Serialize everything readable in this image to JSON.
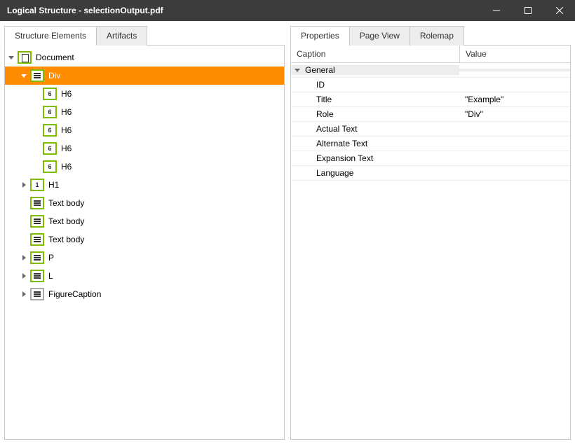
{
  "window": {
    "title": "Logical Structure - selectionOutput.pdf"
  },
  "left_tabs": [
    {
      "label": "Structure Elements",
      "active": true
    },
    {
      "label": "Artifacts",
      "active": false
    }
  ],
  "right_tabs": [
    {
      "label": "Properties",
      "active": true
    },
    {
      "label": "Page View",
      "active": false
    },
    {
      "label": "Rolemap",
      "active": false
    }
  ],
  "tree": [
    {
      "depth": 0,
      "expander": "open",
      "iconText": "",
      "iconClass": "ic-doc",
      "label": "Document",
      "selected": false
    },
    {
      "depth": 1,
      "expander": "open",
      "iconText": "",
      "iconClass": "ic-lines",
      "label": "Div",
      "selected": true
    },
    {
      "depth": 2,
      "expander": "none",
      "iconText": "6",
      "iconClass": "",
      "label": "H6",
      "selected": false
    },
    {
      "depth": 2,
      "expander": "none",
      "iconText": "6",
      "iconClass": "",
      "label": "H6",
      "selected": false
    },
    {
      "depth": 2,
      "expander": "none",
      "iconText": "6",
      "iconClass": "",
      "label": "H6",
      "selected": false
    },
    {
      "depth": 2,
      "expander": "none",
      "iconText": "6",
      "iconClass": "",
      "label": "H6",
      "selected": false
    },
    {
      "depth": 2,
      "expander": "none",
      "iconText": "6",
      "iconClass": "",
      "label": "H6",
      "selected": false
    },
    {
      "depth": 1,
      "expander": "closed",
      "iconText": "1",
      "iconClass": "",
      "label": "H1",
      "selected": false
    },
    {
      "depth": 1,
      "expander": "none",
      "iconText": "",
      "iconClass": "ic-lines",
      "label": "Text body",
      "selected": false
    },
    {
      "depth": 1,
      "expander": "none",
      "iconText": "",
      "iconClass": "ic-lines",
      "label": "Text body",
      "selected": false
    },
    {
      "depth": 1,
      "expander": "none",
      "iconText": "",
      "iconClass": "ic-lines",
      "label": "Text body",
      "selected": false
    },
    {
      "depth": 1,
      "expander": "closed",
      "iconText": "",
      "iconClass": "ic-lines",
      "label": "P",
      "selected": false
    },
    {
      "depth": 1,
      "expander": "closed",
      "iconText": "",
      "iconClass": "ic-lines",
      "label": "L",
      "selected": false
    },
    {
      "depth": 1,
      "expander": "closed",
      "iconText": "",
      "iconClass": "ic-lines gray",
      "label": "FigureCaption",
      "selected": false
    }
  ],
  "props_header": {
    "caption": "Caption",
    "value": "Value"
  },
  "props": {
    "group": "General",
    "rows": [
      {
        "caption": "ID",
        "value": ""
      },
      {
        "caption": "Title",
        "value": "\"Example\""
      },
      {
        "caption": "Role",
        "value": "\"Div\""
      },
      {
        "caption": "Actual Text",
        "value": ""
      },
      {
        "caption": "Alternate Text",
        "value": ""
      },
      {
        "caption": "Expansion Text",
        "value": ""
      },
      {
        "caption": "Language",
        "value": ""
      }
    ]
  }
}
